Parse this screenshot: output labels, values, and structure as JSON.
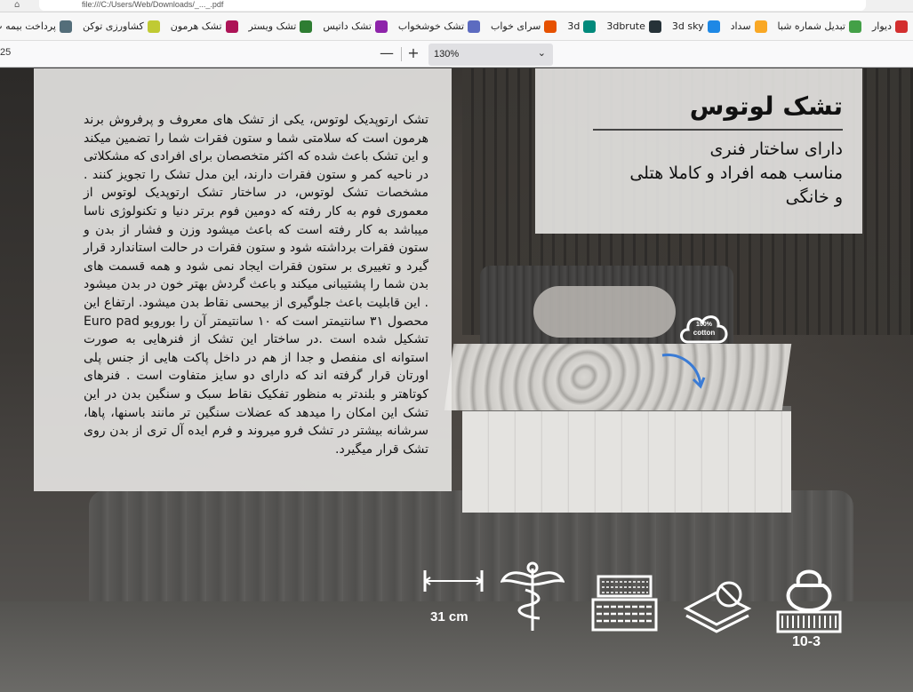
{
  "browser": {
    "url": "file:///C:/Users/Web/Downloads/_..._.pdf"
  },
  "bookmarks": [
    {
      "label": "دیوار",
      "icon_color": "#d32f2f",
      "icon": "divar-icon"
    },
    {
      "label": "تبدیل شماره شبا",
      "icon_color": "#43a047",
      "icon": "sheba-icon"
    },
    {
      "label": "سداد",
      "icon_color": "#f9a825",
      "icon": "sadad-icon"
    },
    {
      "label": "3d sky",
      "icon_color": "#1e88e5",
      "icon": "3dsky-icon"
    },
    {
      "label": "3dbrute",
      "icon_color": "#263238",
      "icon": "3dbrute-icon"
    },
    {
      "label": "3d",
      "icon_color": "#00897b",
      "icon": "3d-icon"
    },
    {
      "label": "سرای خواب",
      "icon_color": "#e65100",
      "icon": "moon-icon"
    },
    {
      "label": "تشک خوشخواب",
      "icon_color": "#5c6bc0",
      "icon": "khoshkhab-icon"
    },
    {
      "label": "تشک داتیس",
      "icon_color": "#8e24aa",
      "icon": "datis-icon"
    },
    {
      "label": "تشک ویستر",
      "icon_color": "#2e7d32",
      "icon": "wister-icon"
    },
    {
      "label": "تشک هرمون",
      "icon_color": "#ad1457",
      "icon": "hermon-icon"
    },
    {
      "label": "کشاورزی توکن",
      "icon_color": "#c0ca33",
      "icon": "token-icon"
    },
    {
      "label": "پرداخت بیمه ت",
      "icon_color": "#546e7a",
      "icon": "insurance-icon"
    }
  ],
  "pdf_toolbar": {
    "page_partial": "25",
    "zoom_out": "—",
    "zoom_in": "+",
    "zoom": "130%"
  },
  "product": {
    "title": "تشک لوتوس",
    "subtitle_lines": [
      "دارای ساختار فنری",
      "مناسب همه افراد و کاملا هتلی",
      "و خانگی"
    ],
    "description": "تشک ارتوپدیک لوتوس، یکی از تشک های معروف و پرفروش برند هرمون است که سلامتی شما و ستون فقرات شما را تضمین میکند و این تشک باعث شده که اکثر متخصصان برای افرادی که مشکلاتی در ناحیه کمر و  ستون فقرات دارند، این مدل تشک را تجویز کنند . مشخصات تشک لوتوس، در ساختار تشک ارتوپدیک لوتوس از معموری فوم به کار رفته که دومین فوم برتر دنیا و تکنولوژی ناسا میباشد به کار رفته است که باعث میشود وزن و فشار از بدن و ستون فقرات برداشته شود و ستون فقرات در حالت استاندارد قرار گیرد و تغییری بر ستون فقرات ایجاد نمی شود و همه قسمت های بدن شما را پشتیبانی میکند و باعث گردش بهتر خون در بدن میشود . این قابلیت باعث جلوگیری از بیحسی نقاط بدن میشود. ارتفاع این محصول ۳۱ سانتیمتر است که ۱۰ سانتیمتر آن را بورویو Euro pad تشکیل شده است .در ساختار این تشک از فنرهایی به صورت استوانه ای منفصل و جدا از هم در داخل پاکت هایی از جنس پلی اورتان قرار گرفته اند که دارای دو سایز متفاوت است . فنرهای کوتاهتر و بلندتر به منظور تفکیک نقاط سبک و سنگین بدن در این تشک این امکان را میدهد که عضلات سنگین تر مانند باسنها، پاها، سرشانه بیشتر در تشک فرو میروند و فرم ایده آل تری از بدن روی تشک قرار میگیرد.",
    "cotton_badge": {
      "percent": "100%",
      "word": "cotton"
    },
    "features": {
      "height_label": "31 cm",
      "weight_label": "10-3"
    }
  }
}
